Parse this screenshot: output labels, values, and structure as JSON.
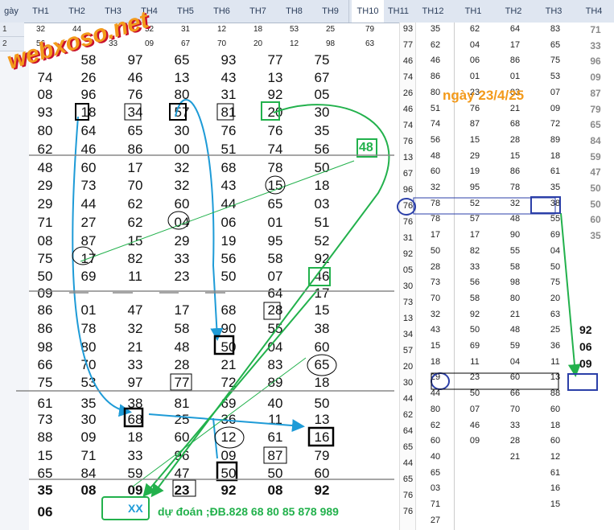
{
  "header": {
    "row_label": "gày",
    "main_cols": [
      "TH1",
      "TH2",
      "TH3",
      "TH4",
      "TH5",
      "TH6",
      "TH7",
      "TH8",
      "TH9"
    ],
    "mid_cols": [
      "TH10",
      "TH11"
    ],
    "col12": "TH12",
    "right_cols": [
      "TH1",
      "TH2",
      "TH3",
      "TH4"
    ]
  },
  "top_rows": {
    "r1": {
      "num": "1",
      "vals": [
        "32",
        "44",
        "",
        "52",
        "31",
        "12",
        "18",
        "53",
        "25",
        "79"
      ]
    },
    "r2": {
      "num": "2",
      "vals": [
        "56",
        "",
        "33",
        "09",
        "67",
        "70",
        "20",
        "12",
        "98",
        "63"
      ]
    }
  },
  "logo": {
    "text": "webxoso.net"
  },
  "main_grid": [
    [
      "",
      "58",
      "97",
      "65",
      "93",
      "77",
      "75"
    ],
    [
      "74",
      "26",
      "46",
      "13",
      "43",
      "13",
      "67"
    ],
    [
      "08",
      "96",
      "76",
      "80",
      "31",
      "92",
      "05"
    ],
    [
      "93",
      "18",
      "34",
      "57",
      "81",
      "20",
      "30"
    ],
    [
      "80",
      "64",
      "65",
      "30",
      "76",
      "76",
      "35"
    ],
    [
      "62",
      "46",
      "86",
      "00",
      "51",
      "74",
      "56"
    ],
    [
      "48",
      "60",
      "17",
      "32",
      "68",
      "78",
      "50"
    ],
    [
      "29",
      "73",
      "70",
      "32",
      "43",
      "15",
      "18"
    ],
    [
      "29",
      "44",
      "62",
      "60",
      "44",
      "65",
      "03"
    ],
    [
      "71",
      "27",
      "62",
      "04",
      "06",
      "01",
      "51"
    ],
    [
      "08",
      "87",
      "15",
      "29",
      "19",
      "95",
      "52"
    ],
    [
      "75",
      "17",
      "82",
      "33",
      "56",
      "58",
      "92"
    ],
    [
      "50",
      "69",
      "11",
      "23",
      "50",
      "07",
      "46"
    ],
    [
      "09",
      "",
      "",
      "",
      "",
      "64",
      "17"
    ],
    [
      "86",
      "01",
      "47",
      "17",
      "68",
      "28",
      "15"
    ],
    [
      "86",
      "78",
      "32",
      "58",
      "90",
      "55",
      "38"
    ],
    [
      "98",
      "80",
      "21",
      "48",
      "50",
      "04",
      "60"
    ],
    [
      "66",
      "70",
      "33",
      "28",
      "21",
      "83",
      "65"
    ],
    [
      "75",
      "53",
      "97",
      "77",
      "72",
      "89",
      "18"
    ],
    [
      "61",
      "35",
      "38",
      "81",
      "69",
      "40",
      "50"
    ],
    [
      "73",
      "30",
      "68",
      "25",
      "36",
      "11",
      "13"
    ],
    [
      "88",
      "09",
      "18",
      "60",
      "12",
      "61",
      "16"
    ],
    [
      "15",
      "71",
      "33",
      "96",
      "09",
      "87",
      "79"
    ],
    [
      "65",
      "84",
      "59",
      "47",
      "50",
      "50",
      "60"
    ],
    [
      "35",
      "08",
      "09",
      "23",
      "92",
      "08",
      "92"
    ],
    [
      "06",
      "",
      "",
      "",
      "",
      "",
      ""
    ]
  ],
  "box_48": "48",
  "xx_label": "XX",
  "prediction_text": "dự đoán ;ĐB.828 68 80  85 878 989",
  "date_label": "ngày 23/4/25",
  "mid_col": [
    "93",
    "77",
    "46",
    "74",
    "26",
    "46",
    "74",
    "76",
    "13",
    "67",
    "96",
    "76",
    "76",
    "31",
    "92",
    "05",
    "30",
    "73",
    "13",
    "34",
    "57",
    "20",
    "30",
    "44",
    "62",
    "64",
    "65",
    "44",
    "65",
    "76",
    "76"
  ],
  "col12": [
    "35",
    "62",
    "46",
    "86",
    "80",
    "51",
    "74",
    "56",
    "48",
    "60",
    "32",
    "78",
    "78",
    "17",
    "50",
    "28",
    "73",
    "70",
    "32",
    "43",
    "15",
    "18",
    "29",
    "44",
    "80",
    "62",
    "60",
    "40",
    "65",
    "03",
    "71",
    "27"
  ],
  "right_grid": [
    [
      "62",
      "64",
      "83",
      "71"
    ],
    [
      "04",
      "17",
      "65",
      "33"
    ],
    [
      "06",
      "86",
      "75",
      "96"
    ],
    [
      "01",
      "01",
      "53",
      "09"
    ],
    [
      "23",
      "03",
      "07",
      "87"
    ],
    [
      "76",
      "21",
      "09",
      "79"
    ],
    [
      "87",
      "68",
      "72",
      "65"
    ],
    [
      "15",
      "28",
      "89",
      "84"
    ],
    [
      "29",
      "15",
      "18",
      "59"
    ],
    [
      "19",
      "86",
      "61",
      "47"
    ],
    [
      "95",
      "78",
      "35",
      "50"
    ],
    [
      "52",
      "32",
      "38",
      "50"
    ],
    [
      "57",
      "48",
      "55",
      "60"
    ],
    [
      "17",
      "90",
      "69",
      "35"
    ],
    [
      "82",
      "55",
      "04",
      ""
    ],
    [
      "33",
      "58",
      "50",
      ""
    ],
    [
      "56",
      "98",
      "75",
      ""
    ],
    [
      "58",
      "80",
      "20",
      ""
    ],
    [
      "92",
      "21",
      "63",
      ""
    ],
    [
      "50",
      "48",
      "25",
      ""
    ],
    [
      "69",
      "59",
      "36",
      ""
    ],
    [
      "11",
      "04",
      "11",
      ""
    ],
    [
      "23",
      "60",
      "13",
      ""
    ],
    [
      "50",
      "66",
      "88",
      ""
    ],
    [
      "07",
      "70",
      "60",
      ""
    ],
    [
      "46",
      "33",
      "18",
      ""
    ],
    [
      "09",
      "28",
      "60",
      ""
    ],
    [
      "",
      "21",
      "12",
      ""
    ],
    [
      "",
      "",
      "61",
      ""
    ],
    [
      "",
      "",
      "16",
      ""
    ],
    [
      "",
      "",
      "15",
      ""
    ]
  ],
  "right_pred": [
    "92",
    "06",
    "09"
  ],
  "colors": {
    "accent_blue": "#1e9bd7",
    "accent_green": "#22b14c",
    "orange": "#f39a1b",
    "navy": "#2b3fa8"
  }
}
